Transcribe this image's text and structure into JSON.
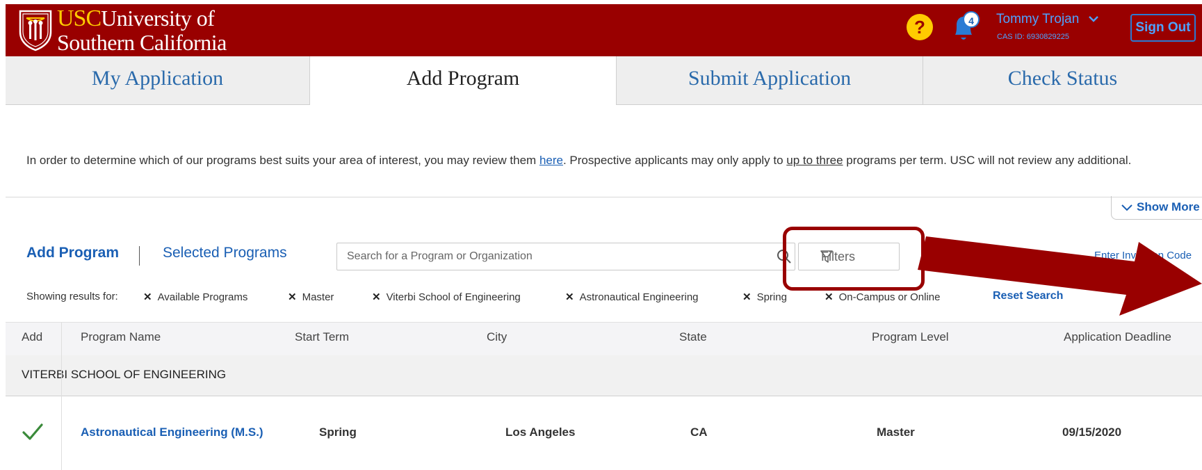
{
  "header": {
    "logo": {
      "usc": "USC",
      "line1": "University of",
      "line2": "Southern California"
    },
    "help_symbol": "?",
    "notification_count": "4",
    "user_name": "Tommy Trojan",
    "cas_id": "CAS ID: 6930829225",
    "sign_out_label": "Sign Out",
    "colors": {
      "brand": "#990000",
      "gold": "#ffcc00",
      "link": "#1a5fb4"
    }
  },
  "tabs": [
    {
      "label": "My Application"
    },
    {
      "label": "Add Program"
    },
    {
      "label": "Submit Application"
    },
    {
      "label": "Check Status"
    }
  ],
  "intro": {
    "before_here": "In order to determine which of our programs best suits your area of interest, you may review them ",
    "here": "here",
    "middle": ". Prospective applicants may only apply to ",
    "up_to_three": "up to three",
    "after": " programs per term. USC will not review any additional."
  },
  "show_more_label": "Show More",
  "program_bar": {
    "add_program": "Add Program",
    "selected_programs": "Selected Programs",
    "search_placeholder": "Search for a Program or Organization",
    "filters_label": "Filters",
    "invite_label": "Enter Invitation Code"
  },
  "filters_applied": {
    "showing_label": "Showing results for:",
    "chips": [
      "Available Programs",
      "Master",
      "Viterbi School of Engineering",
      "Astronautical Engineering",
      "Spring",
      "On-Campus or Online"
    ],
    "reset_label": "Reset Search"
  },
  "table": {
    "columns": [
      "Add",
      "Program Name",
      "Start Term",
      "City",
      "State",
      "Program Level",
      "Application Deadline"
    ],
    "group": "VITERBI SCHOOL OF ENGINEERING",
    "rows": [
      {
        "added": true,
        "program": "Astronautical Engineering (M.S.)",
        "start_term": "Spring",
        "city": "Los Angeles",
        "state": "CA",
        "level": "Master",
        "deadline": "09/15/2020"
      }
    ]
  }
}
